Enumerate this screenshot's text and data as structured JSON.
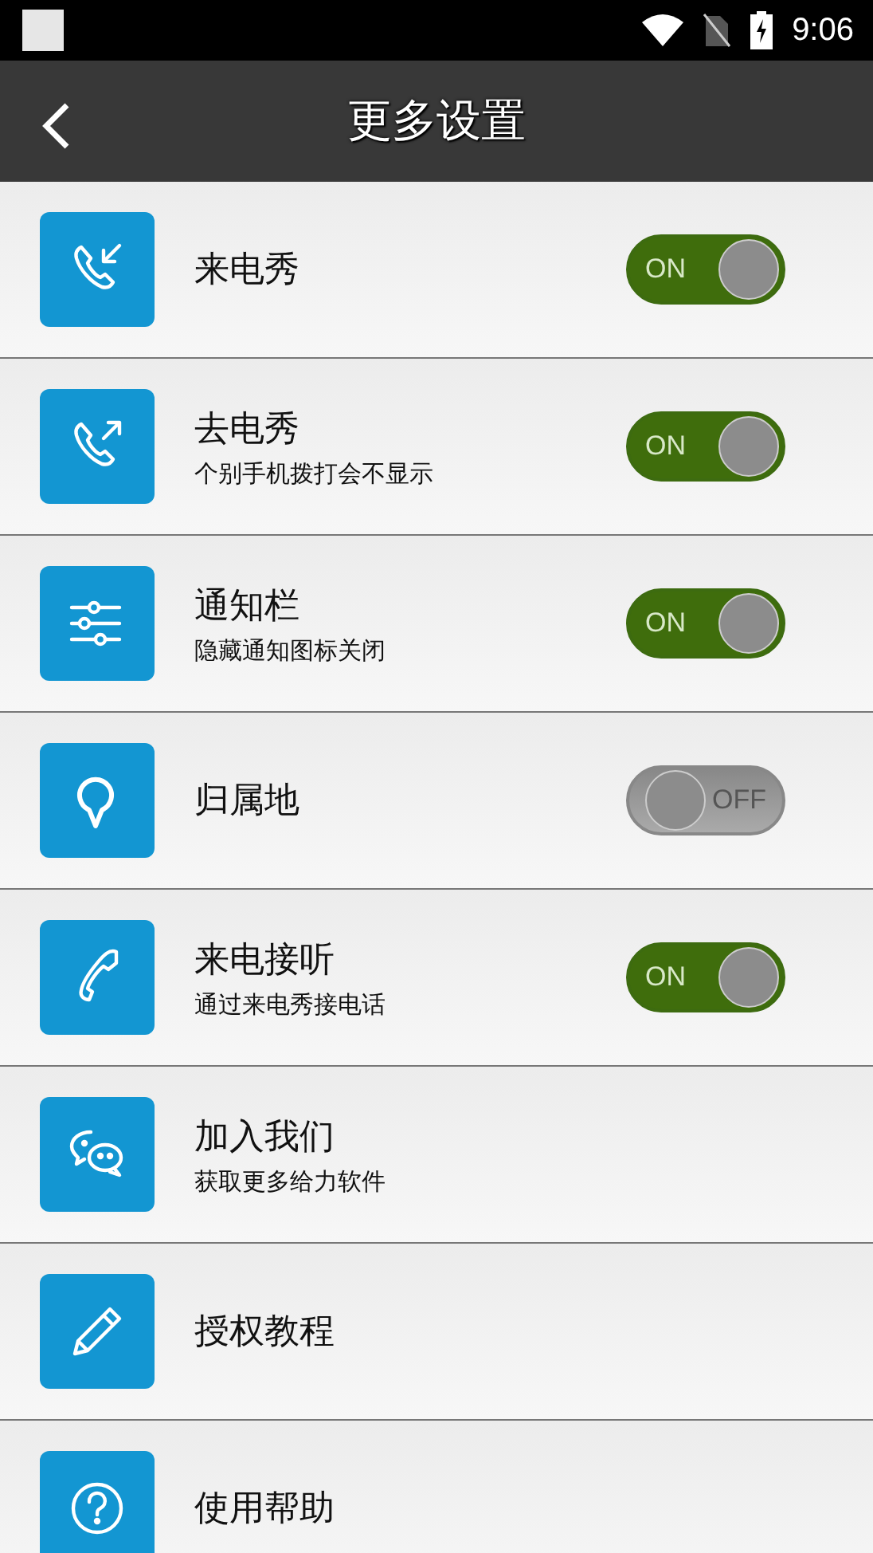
{
  "status_bar": {
    "time": "9:06"
  },
  "header": {
    "title": "更多设置"
  },
  "items": [
    {
      "kind": "toggle",
      "title": "来电秀",
      "on": true,
      "switch_label": "ON"
    },
    {
      "kind": "toggle",
      "title": "去电秀",
      "subtitle": "个别手机拨打会不显示",
      "on": true,
      "switch_label": "ON"
    },
    {
      "kind": "toggle",
      "title": "通知栏",
      "subtitle": "隐藏通知图标关闭",
      "on": true,
      "switch_label": "ON"
    },
    {
      "kind": "toggle",
      "title": "归属地",
      "on": false,
      "switch_label": "OFF"
    },
    {
      "kind": "toggle",
      "title": "来电接听",
      "subtitle": "通过来电秀接电话",
      "on": true,
      "switch_label": "ON"
    },
    {
      "kind": "link",
      "title": "加入我们",
      "subtitle": "获取更多给力软件"
    },
    {
      "kind": "link",
      "title": "授权教程"
    },
    {
      "kind": "link",
      "title": "使用帮助"
    }
  ]
}
